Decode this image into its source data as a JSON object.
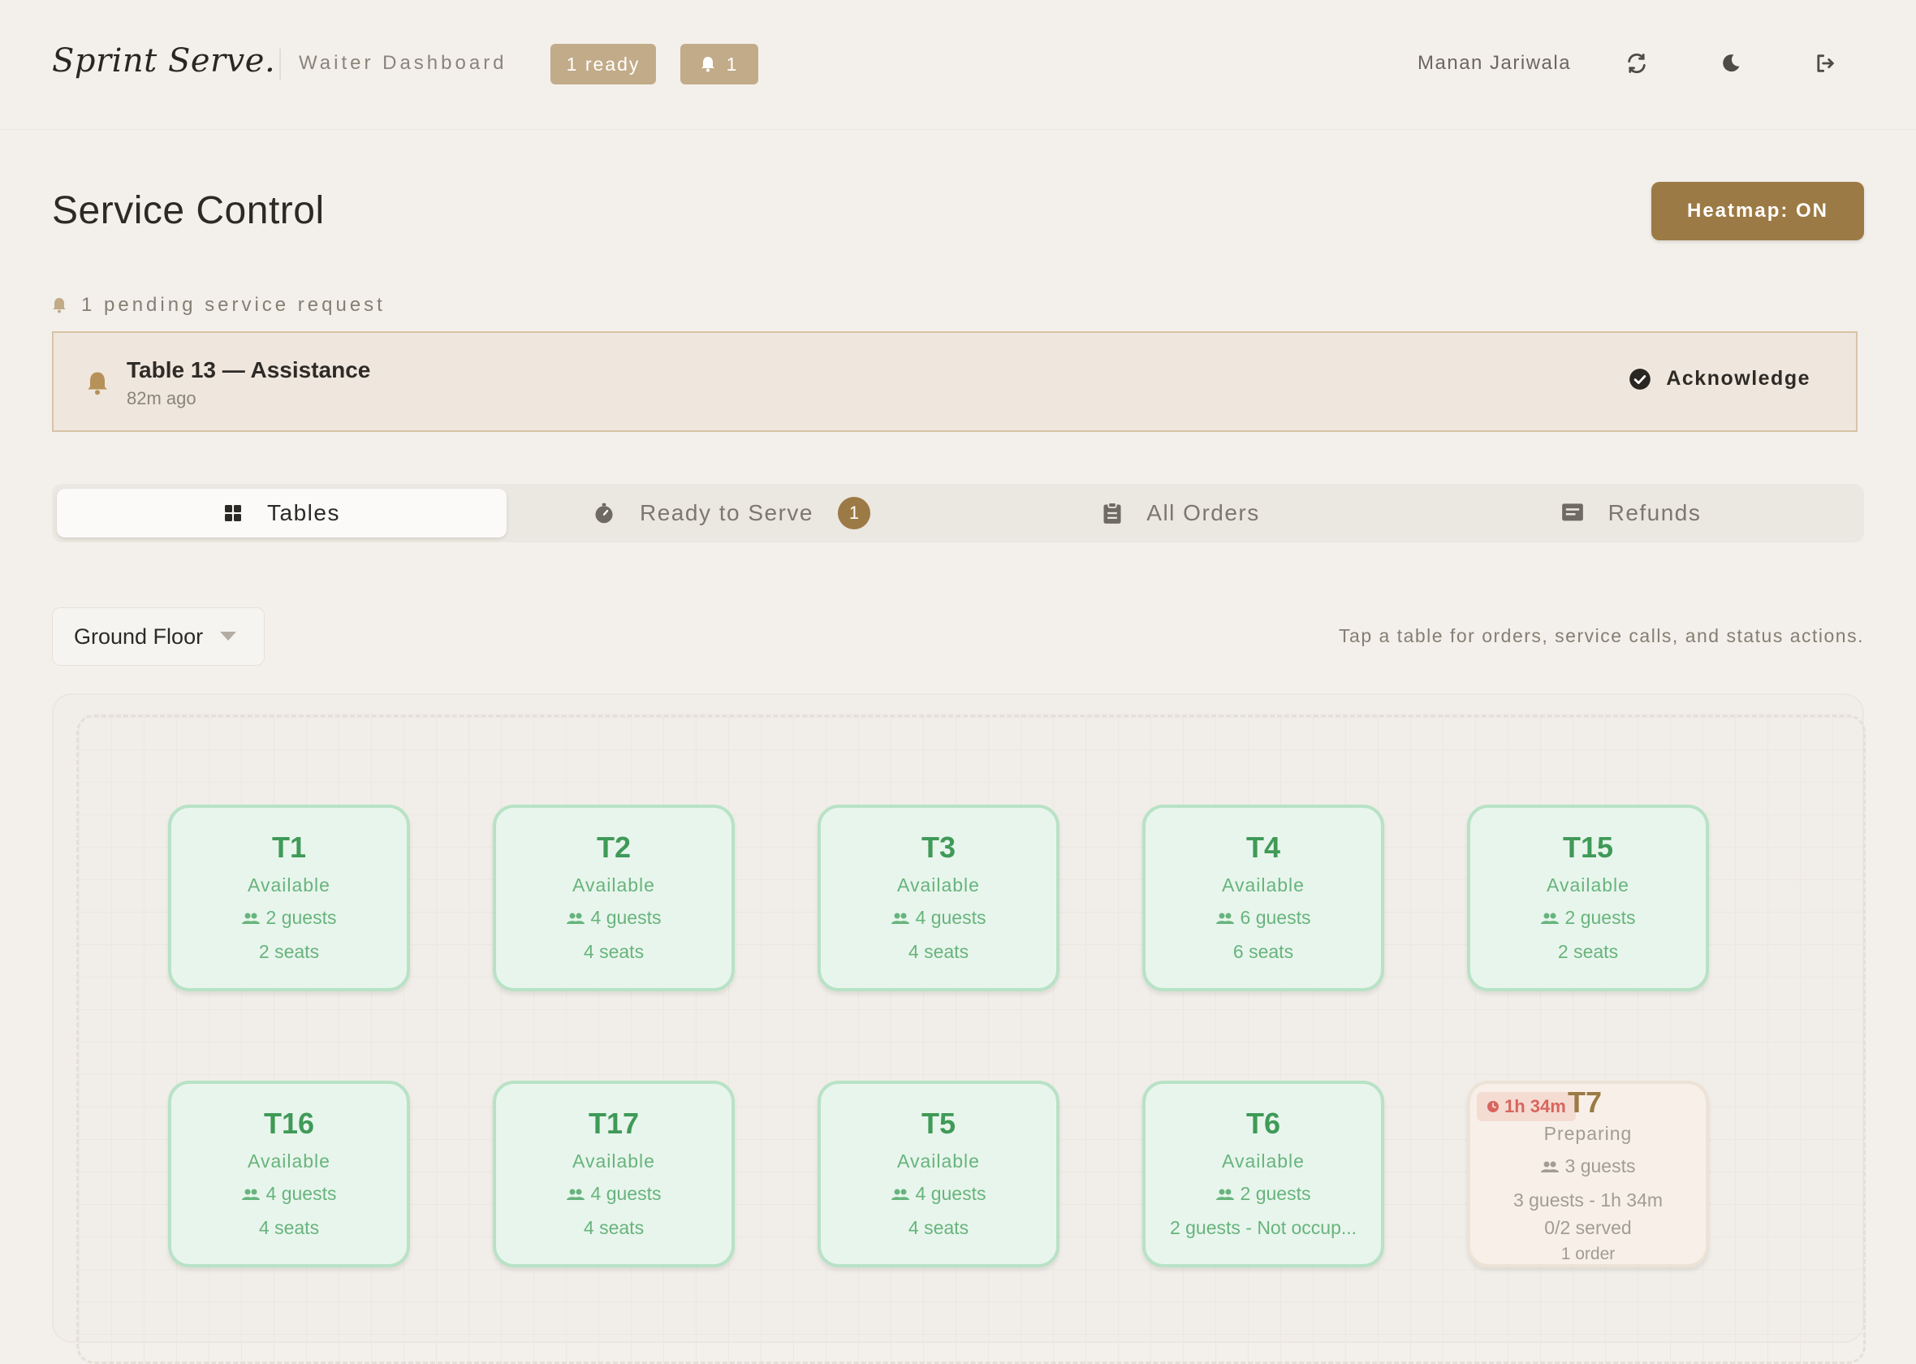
{
  "header": {
    "brand": "Sprint Serve.",
    "dashboard_label": "Waiter Dashboard",
    "ready_pill": "1 ready",
    "bell_count": "1",
    "user_name": "Manan Jariwala",
    "icons": [
      "refresh-icon",
      "moon-icon",
      "logout-icon"
    ]
  },
  "page": {
    "title": "Service Control",
    "heatmap_button": "Heatmap: ON"
  },
  "pending": {
    "label": "1 pending service request",
    "requests": [
      {
        "title": "Table 13 — Assistance",
        "time": "82m ago",
        "action": "Acknowledge"
      }
    ]
  },
  "tabs": [
    {
      "label": "Tables",
      "icon": "grid-icon",
      "active": true
    },
    {
      "label": "Ready to Serve",
      "icon": "timer-icon",
      "badge": "1"
    },
    {
      "label": "All Orders",
      "icon": "clipboard-icon"
    },
    {
      "label": "Refunds",
      "icon": "receipt-icon"
    }
  ],
  "floor": {
    "selected": "Ground Floor",
    "hint": "Tap a table for orders, service calls, and status actions."
  },
  "tables": [
    {
      "name": "T1",
      "status": "Available",
      "guests": "2 guests",
      "seats": "2 seats"
    },
    {
      "name": "T2",
      "status": "Available",
      "guests": "4 guests",
      "seats": "4 seats"
    },
    {
      "name": "T3",
      "status": "Available",
      "guests": "4 guests",
      "seats": "4 seats"
    },
    {
      "name": "T4",
      "status": "Available",
      "guests": "6 guests",
      "seats": "6 seats"
    },
    {
      "name": "T15",
      "status": "Available",
      "guests": "2 guests",
      "seats": "2 seats"
    },
    {
      "name": "T16",
      "status": "Available",
      "guests": "4 guests",
      "seats": "4 seats"
    },
    {
      "name": "T17",
      "status": "Available",
      "guests": "4 guests",
      "seats": "4 seats"
    },
    {
      "name": "T5",
      "status": "Available",
      "guests": "4 guests",
      "seats": "4 seats"
    },
    {
      "name": "T6",
      "status": "Available",
      "guests": "2 guests",
      "seats": "2 guests - Not occup..."
    },
    {
      "name": "T7",
      "status": "Preparing",
      "timer": "1h 34m",
      "guests": "3 guests",
      "detail": "3 guests - 1h 34m",
      "served": "0/2 served",
      "orders": "1 order"
    }
  ],
  "colors": {
    "accent": "#9c7a45",
    "available_bg": "#e8f5ec",
    "available_text": "#3f9a58",
    "timer_red": "#d9655d"
  }
}
